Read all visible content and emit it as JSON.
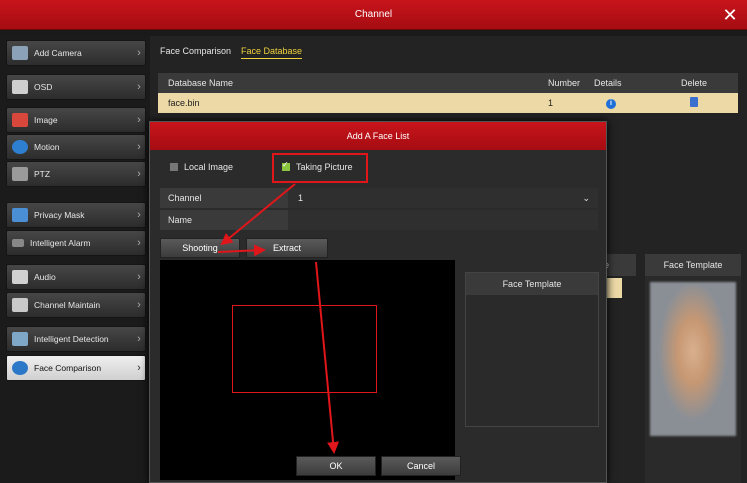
{
  "window": {
    "title": "Channel",
    "close_glyph": "✕"
  },
  "sidebar": {
    "items": [
      {
        "label": "Add Camera",
        "icon": "camera-icon",
        "color": "#8aa1b8"
      },
      {
        "label": "OSD",
        "icon": "document-icon",
        "color": "#cfcfcf"
      },
      {
        "label": "Image",
        "icon": "image-icon",
        "color": "#d8473b"
      },
      {
        "label": "Motion",
        "icon": "motion-icon",
        "color": "#2f7fd0"
      },
      {
        "label": "PTZ",
        "icon": "ptz-icon",
        "color": "#9a9a9a"
      },
      {
        "label": "Privacy Mask",
        "icon": "privacy-mask-icon",
        "color": "#4a8fd4"
      },
      {
        "label": "Intelligent Alarm",
        "icon": "alarm-icon",
        "color": "#888888"
      },
      {
        "label": "Audio",
        "icon": "speaker-icon",
        "color": "#d0d0d0"
      },
      {
        "label": "Channel Maintain",
        "icon": "tools-icon",
        "color": "#c9c9c9"
      },
      {
        "label": "Intelligent Detection",
        "icon": "detection-icon",
        "color": "#7fa8c8"
      },
      {
        "label": "Face Comparison",
        "icon": "face-comparison-icon",
        "color": "#2c78c8",
        "active": true
      }
    ],
    "arrow": "›"
  },
  "tabs": [
    {
      "label": "Face Comparison"
    },
    {
      "label": "Face Database",
      "active": true
    }
  ],
  "table": {
    "headers": {
      "name": "Database Name",
      "number": "Number",
      "details": "Details",
      "delete": "Delete"
    },
    "rows": [
      {
        "name": "face.bin",
        "number": "1"
      }
    ]
  },
  "right_panel": {
    "header": "Face Template"
  },
  "partial_header_text": "e",
  "dialog": {
    "title": "Add A Face List",
    "options": {
      "local_image": "Local Image",
      "taking_picture": "Taking Picture"
    },
    "fields": {
      "channel_label": "Channel",
      "channel_value": "1",
      "name_label": "Name",
      "name_value": ""
    },
    "chevron": "⌄",
    "buttons": {
      "shooting": "Shooting",
      "extract": "Extract",
      "ok": "OK",
      "cancel": "Cancel"
    },
    "template_header": "Face Template"
  },
  "colors": {
    "accent_red": "#c8141b",
    "highlight": "#e0161b",
    "tab_active": "#f0d23c",
    "row_selected": "#ecd9a6"
  }
}
